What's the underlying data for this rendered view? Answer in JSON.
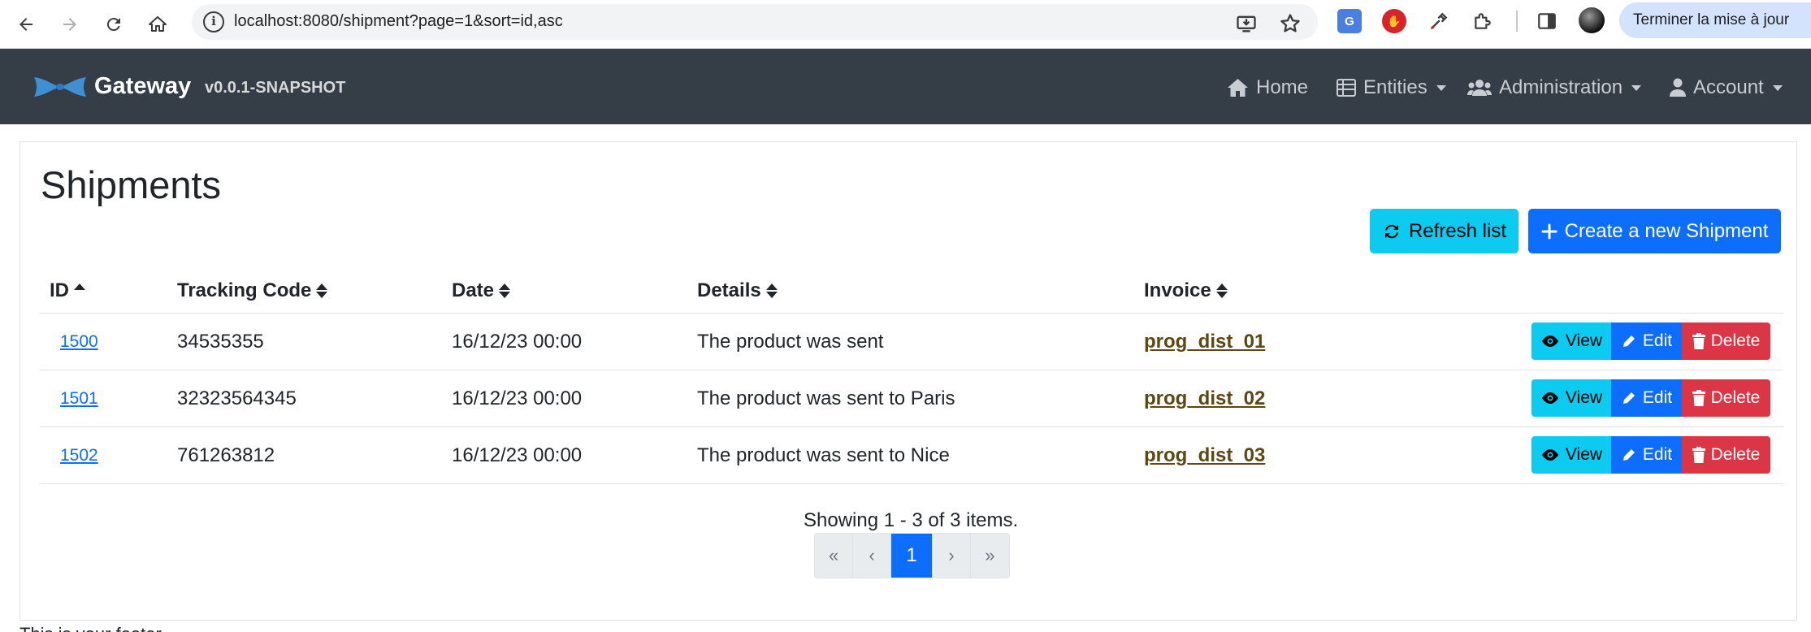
{
  "browser": {
    "url": "localhost:8080/shipment?page=1&sort=id,asc",
    "update_button": "Terminer la mise à jour",
    "extensions": [
      {
        "name": "translate-extension-icon",
        "glyph": "G"
      },
      {
        "name": "adblock-extension-icon",
        "glyph": "✋"
      },
      {
        "name": "eyedropper-extension-icon",
        "glyph": "✎"
      },
      {
        "name": "puzzle-extensions-icon",
        "glyph": "⧉"
      }
    ]
  },
  "navbar": {
    "brand": "Gateway",
    "version": "v0.0.1-SNAPSHOT",
    "items": [
      {
        "label": "Home",
        "icon": "home-icon"
      },
      {
        "label": "Entities",
        "icon": "list-icon"
      },
      {
        "label": "Administration",
        "icon": "users-icon"
      },
      {
        "label": "Account",
        "icon": "user-icon"
      }
    ]
  },
  "page": {
    "title": "Shipments",
    "refresh_label": "Refresh list",
    "create_label": "Create a new Shipment"
  },
  "table": {
    "headers": [
      "ID",
      "Tracking Code",
      "Date",
      "Details",
      "Invoice"
    ],
    "rows": [
      {
        "id": "1500",
        "tracking": "34535355",
        "date": "16/12/23 00:00",
        "details": "The product was sent",
        "invoice": "prog_dist_01"
      },
      {
        "id": "1501",
        "tracking": "32323564345",
        "date": "16/12/23 00:00",
        "details": "The product was sent to Paris",
        "invoice": "prog_dist_02"
      },
      {
        "id": "1502",
        "tracking": "761263812",
        "date": "16/12/23 00:00",
        "details": "The product was sent to Nice",
        "invoice": "prog_dist_03"
      }
    ],
    "actions": {
      "view": "View",
      "edit": "Edit",
      "delete": "Delete"
    }
  },
  "pagination": {
    "summary": "Showing 1 - 3 of 3 items.",
    "first": "«",
    "prev": "‹",
    "current": "1",
    "next": "›",
    "last": "»"
  },
  "footer_text": "This is your footer",
  "colors": {
    "navbar": "#353d47",
    "info": "#0dcaf0",
    "primary": "#0d6efd",
    "danger": "#dc3545",
    "invoice_link": "#5c4813"
  }
}
